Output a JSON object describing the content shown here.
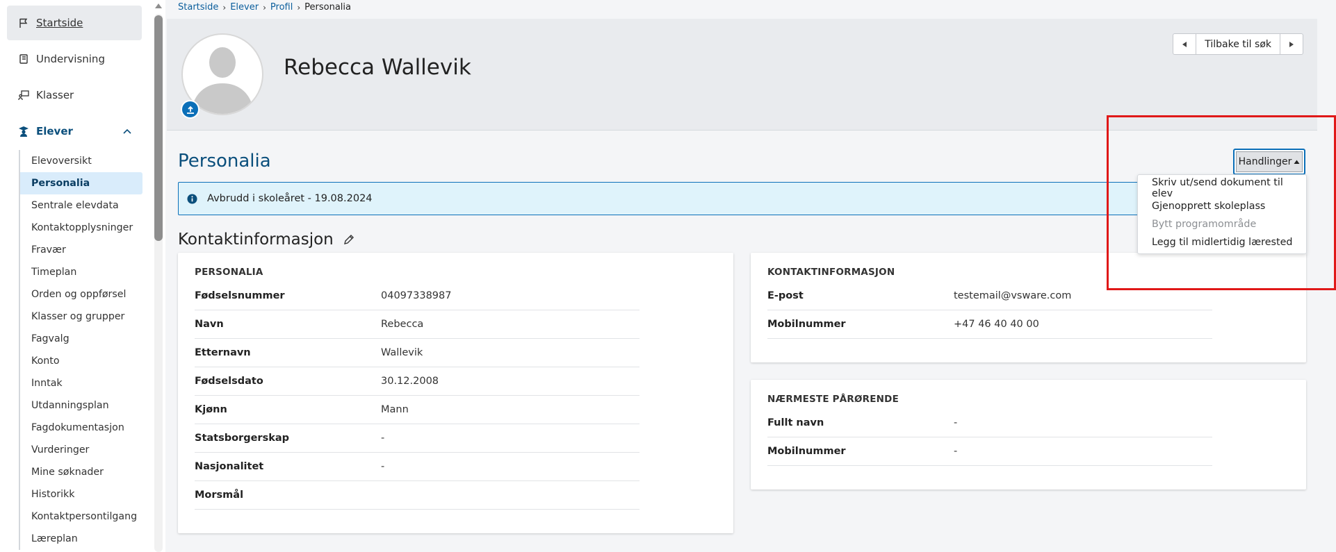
{
  "sidebar": {
    "top_items": [
      {
        "label": "Startside",
        "icon": "flag-icon"
      },
      {
        "label": "Undervisning",
        "icon": "book-icon"
      },
      {
        "label": "Klasser",
        "icon": "classroom-icon"
      },
      {
        "label": "Elever",
        "icon": "student-icon"
      }
    ],
    "sub_items": [
      "Elevoversikt",
      "Personalia",
      "Sentrale elevdata",
      "Kontaktopplysninger",
      "Fravær",
      "Timeplan",
      "Orden og oppførsel",
      "Klasser og grupper",
      "Fagvalg",
      "Konto",
      "Inntak",
      "Utdanningsplan",
      "Fagdokumentasjon",
      "Vurderinger",
      "Mine søknader",
      "Historikk",
      "Kontaktpersontilgang",
      "Læreplan"
    ],
    "active_sub": "Personalia"
  },
  "breadcrumb": [
    "Startside",
    "Elever",
    "Profil",
    "Personalia"
  ],
  "header": {
    "student_name": "Rebecca Wallevik",
    "back_label": "Tilbake til søk"
  },
  "section_title": "Personalia",
  "actions_label": "Handlinger",
  "actions_menu": [
    {
      "label": "Skriv ut/send dokument til elev",
      "disabled": false
    },
    {
      "label": "Gjenopprett skoleplass",
      "disabled": false
    },
    {
      "label": "Bytt programområde",
      "disabled": true
    },
    {
      "label": "Legg til midlertidig lærested",
      "disabled": false
    }
  ],
  "alert_text": "Avbrudd i skoleåret - 19.08.2024",
  "kontakt_title": "Kontaktinformasjon",
  "personalia_card": {
    "heading": "PERSONALIA",
    "rows": [
      {
        "key": "Fødselsnummer",
        "value": "04097338987"
      },
      {
        "key": "Navn",
        "value": "Rebecca"
      },
      {
        "key": "Etternavn",
        "value": "Wallevik"
      },
      {
        "key": "Fødselsdato",
        "value": "30.12.2008"
      },
      {
        "key": "Kjønn",
        "value": "Mann"
      },
      {
        "key": "Statsborgerskap",
        "value": "-"
      },
      {
        "key": "Nasjonalitet",
        "value": "-"
      },
      {
        "key": "Morsmål",
        "value": ""
      }
    ]
  },
  "kontakt_card": {
    "heading": "KONTAKTINFORMASJON",
    "rows": [
      {
        "key": "E-post",
        "value": "testemail@vsware.com"
      },
      {
        "key": "Mobilnummer",
        "value": "+47 46 40 40 00"
      }
    ]
  },
  "parorende_card": {
    "heading": "NÆRMESTE PÅRØRENDE",
    "rows": [
      {
        "key": "Fullt navn",
        "value": "-"
      },
      {
        "key": "Mobilnummer",
        "value": "-"
      }
    ]
  },
  "colors": {
    "accent": "#0b6fb8",
    "nav_text": "#0b4f7c",
    "alert_bg": "#dff3fb",
    "active_bg": "#d9ecfb",
    "highlight": "#e01818"
  }
}
